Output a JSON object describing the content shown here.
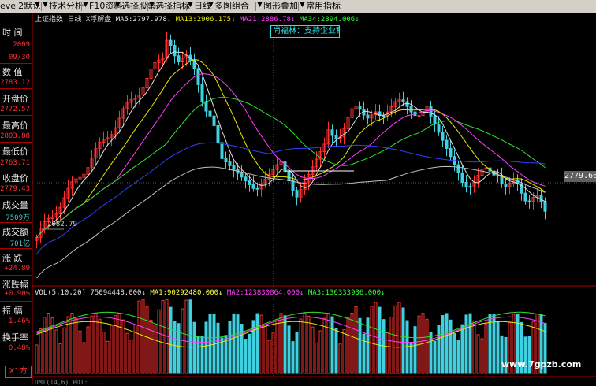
{
  "toolbar": {
    "items": [
      "evel2默认",
      "技术分析",
      "F10资料",
      "选择股票",
      "选择指标",
      "日线",
      "多图组合",
      "图形叠加",
      "常用指标"
    ]
  },
  "header": {
    "index_name": "上证指数",
    "period": "日线",
    "restore": "X浮解盘",
    "ma5_label": "MA5:",
    "ma5": "2797.978",
    "ma13_label": "MA13:",
    "ma13": "2906.175",
    "ma21_label": "MA21:",
    "ma21": "2886.78",
    "ma34_label": "MA34:",
    "ma34": "2894.006"
  },
  "tooltip": "尚福林：支持企业利用",
  "price_box": "2779.66",
  "low_label": "2682.79",
  "left_panel": {
    "time_label": "时  间",
    "year": "2009",
    "date": "09/30",
    "value_label": "数  值",
    "value": "2783.12",
    "open_label": "开盘价",
    "open": "2772.57",
    "high_label": "最高价",
    "high": "2803.88",
    "low_label": "最低价",
    "low": "2763.71",
    "close_label": "收盘价",
    "close": "2779.43",
    "volume_label": "成交量",
    "volume": "7509万",
    "amount_label": "成交额",
    "amount": "701亿",
    "change_label": "涨  跌",
    "change": "+24.89",
    "pct_label": "涨跌幅",
    "pct": "+0.90%",
    "amp_label": "振  幅",
    "amp": "1.46%",
    "turnover_label": "换手率",
    "turnover": "0.48%"
  },
  "vol_header": {
    "label": "VOL(5,10,20)",
    "vol": "75094448.000",
    "ma1_label": "MA1:",
    "ma1": "90292480.000",
    "ma2_label": "MA2:",
    "ma2": "123830864.000",
    "ma3_label": "MA3:",
    "ma3": "136333936.000"
  },
  "bottom_header": "DMI(14,6)  PDI:  ...",
  "watermark": "www.7gpzb.com",
  "x1_button": "X1方",
  "colors": {
    "up": "#ff3030",
    "down": "#40d0e0",
    "ma5": "#e0e0e0",
    "ma13": "#e8e800",
    "ma21": "#ff40ff",
    "ma34": "#30e030",
    "ma_long": "#3040ff"
  },
  "chart_data": {
    "type": "candlestick",
    "visible_price_range": [
      2600,
      3480
    ],
    "last_close": 2779.66,
    "volume_bars_count": 130
  }
}
